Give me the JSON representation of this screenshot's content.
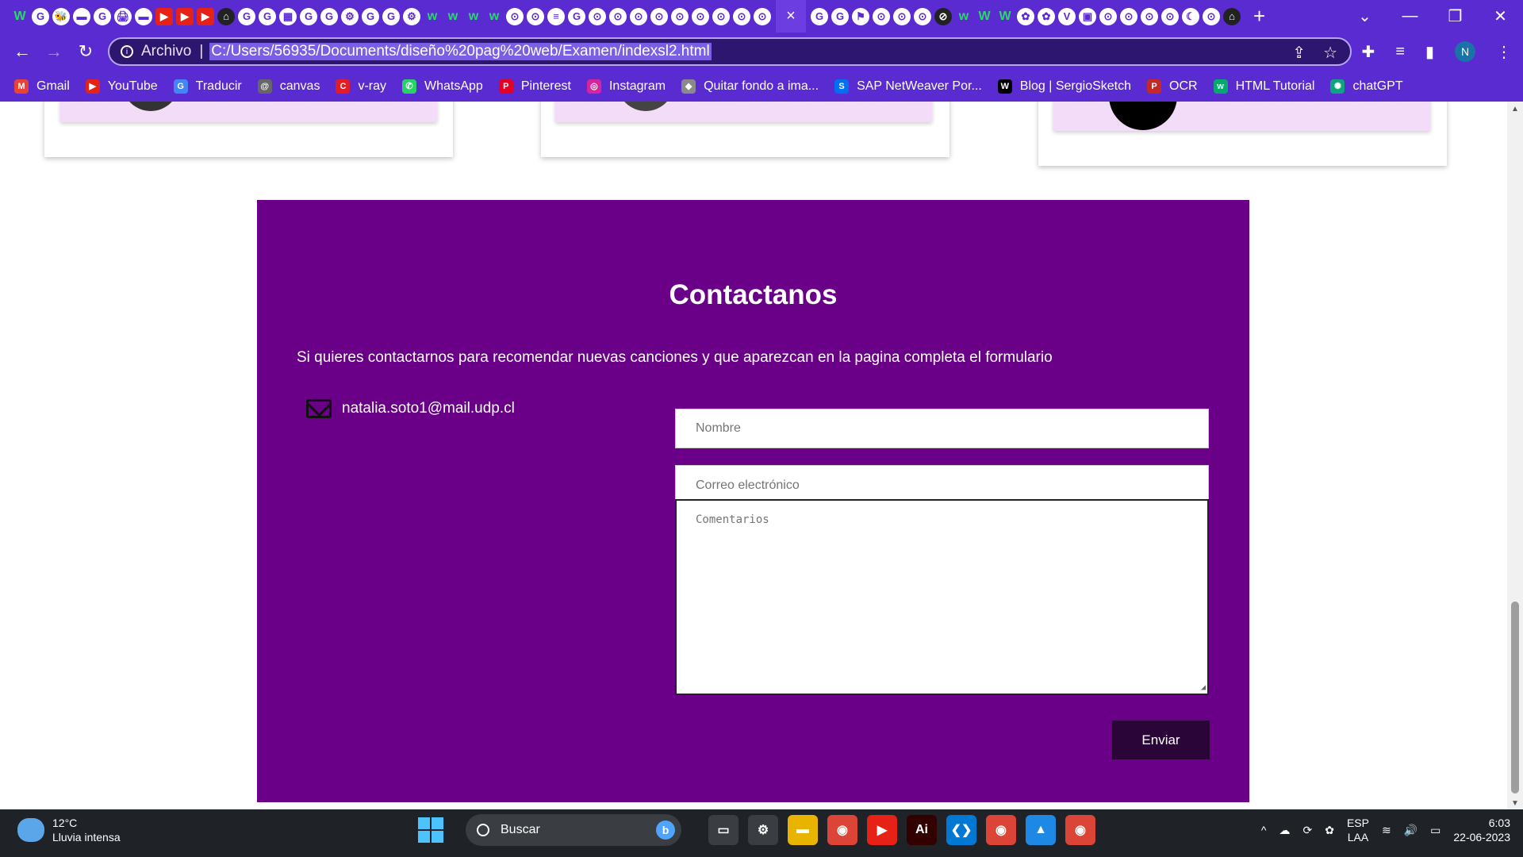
{
  "browser": {
    "tab_strip": {
      "icons": [
        "W",
        "G",
        "🐝",
        "▬",
        "G",
        "🖨",
        "▬",
        "▶",
        "▶",
        "▶",
        "⌂",
        "G",
        "G",
        "▦",
        "G",
        "G",
        "⚙",
        "G",
        "G",
        "⚙",
        "w",
        "w",
        "w",
        "w",
        "⊙",
        "⊙",
        "≡",
        "G",
        "⊙",
        "⊙",
        "⊙",
        "⊙",
        "⊙",
        "⊙",
        "⊙",
        "⊙",
        "⊙"
      ],
      "active_close": "×",
      "icons_after": [
        "G",
        "G",
        "⚑",
        "⊙",
        "⊙",
        "⊙",
        "⊘",
        "w",
        "W",
        "W",
        "✿",
        "✿",
        "V",
        "▣",
        "⊙",
        "⊙",
        "⊙",
        "⊙",
        "☾",
        "⊙",
        "⌂"
      ],
      "new_tab": "+"
    },
    "window_controls": {
      "dropdown": "⌄",
      "minimize": "—",
      "restore": "❐",
      "close": "✕"
    },
    "toolbar": {
      "back": "←",
      "forward": "→",
      "reload": "↻",
      "info": "i",
      "scheme": "Archivo",
      "separator": "|",
      "url": "C:/Users/56935/Documents/diseño%20pag%20web/Examen/indexsl2.html",
      "share": "⇪",
      "star": "☆",
      "extensions": "✚",
      "media": "≡",
      "sidepanel": "▮",
      "profile": "N",
      "menu": "⋮"
    },
    "bookmarks": [
      {
        "label": "Gmail",
        "icon": "M",
        "color": "#ea4335"
      },
      {
        "label": "YouTube",
        "icon": "▶",
        "color": "#e62117"
      },
      {
        "label": "Traducir",
        "icon": "G",
        "color": "#4285f4"
      },
      {
        "label": "canvas",
        "icon": "@",
        "color": "#666666"
      },
      {
        "label": "v-ray",
        "icon": "C",
        "color": "#e31b23"
      },
      {
        "label": "WhatsApp",
        "icon": "✆",
        "color": "#25d366"
      },
      {
        "label": "Pinterest",
        "icon": "P",
        "color": "#e60023"
      },
      {
        "label": "Instagram",
        "icon": "◎",
        "color": "#d6249f"
      },
      {
        "label": "Quitar fondo a ima...",
        "icon": "◆",
        "color": "#8a8a8a"
      },
      {
        "label": "SAP NetWeaver Por...",
        "icon": "S",
        "color": "#0070f2"
      },
      {
        "label": "Blog | SergioSketch",
        "icon": "W",
        "color": "#000000"
      },
      {
        "label": "OCR",
        "icon": "P",
        "color": "#c62828"
      },
      {
        "label": "HTML Tutorial",
        "icon": "w",
        "color": "#04aa6d"
      },
      {
        "label": "chatGPT",
        "icon": "✺",
        "color": "#10a37f"
      }
    ]
  },
  "page": {
    "contact": {
      "title": "Contactanos",
      "lead": "Si quieres contactarnos para recomendar nuevas canciones y que aparezcan en la pagina completa el formulario",
      "email": "natalia.soto1@mail.udp.cl",
      "name_placeholder": "Nombre",
      "email_placeholder": "Correo electrónico",
      "comments_placeholder": "Comentarios",
      "submit_label": "Enviar"
    },
    "scrollbar": {
      "up": "▲",
      "down": "▼"
    }
  },
  "taskbar": {
    "weather": {
      "temp": "12°C",
      "desc": "Lluvia intensa"
    },
    "search_label": "Buscar",
    "bing": "b",
    "apps": [
      {
        "name": "task-view",
        "glyph": "▭",
        "bg": "#3a3d42"
      },
      {
        "name": "settings",
        "glyph": "⚙",
        "bg": "#3a3d42"
      },
      {
        "name": "file-explorer",
        "glyph": "▬",
        "bg": "#e8b400"
      },
      {
        "name": "chrome",
        "glyph": "◉",
        "bg": "#db4437"
      },
      {
        "name": "youtube-pwa",
        "glyph": "▶",
        "bg": "#e62117"
      },
      {
        "name": "illustrator",
        "glyph": "Ai",
        "bg": "#330000"
      },
      {
        "name": "vscode",
        "glyph": "❮❯",
        "bg": "#0078d4"
      },
      {
        "name": "chrome-profile",
        "glyph": "◉",
        "bg": "#db4437"
      },
      {
        "name": "photos",
        "glyph": "▲",
        "bg": "#1e88e5"
      },
      {
        "name": "chrome-2",
        "glyph": "◉",
        "bg": "#db4437"
      }
    ],
    "tray": {
      "chevron": "^",
      "cloud": "☁",
      "sync": "⟳",
      "app": "✿",
      "lang_top": "ESP",
      "lang_bottom": "LAA",
      "wifi": "≋",
      "volume": "🔊",
      "battery": "▭",
      "time": "6:03",
      "date": "22-06-2023"
    }
  }
}
